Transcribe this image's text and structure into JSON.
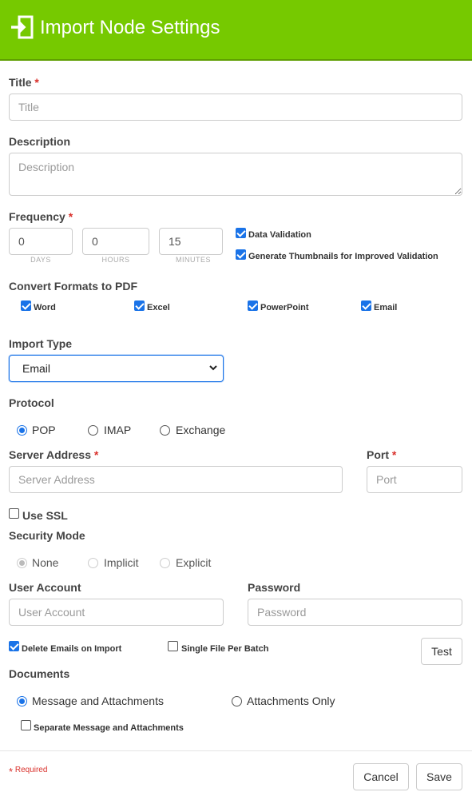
{
  "header": {
    "title": "Import Node Settings",
    "icon": "import-icon",
    "bg_color": "#76c900"
  },
  "title_field": {
    "label": "Title",
    "placeholder": "Title",
    "value": ""
  },
  "description_field": {
    "label": "Description",
    "placeholder": "Description",
    "value": ""
  },
  "frequency": {
    "label": "Frequency",
    "days": {
      "value": "0",
      "caption": "DAYS"
    },
    "hours": {
      "value": "0",
      "caption": "HOURS"
    },
    "minutes": {
      "value": "15",
      "caption": "MINUTES"
    },
    "data_validation": {
      "label": "Data Validation",
      "checked": true
    },
    "generate_thumbnails": {
      "label": "Generate Thumbnails for Improved Validation",
      "checked": true
    }
  },
  "convert_formats": {
    "label": "Convert Formats to PDF",
    "items": [
      {
        "label": "Word",
        "checked": true
      },
      {
        "label": "Excel",
        "checked": true
      },
      {
        "label": "PowerPoint",
        "checked": true
      },
      {
        "label": "Email",
        "checked": true
      }
    ]
  },
  "import_type": {
    "label": "Import Type",
    "selected": "Email"
  },
  "protocol": {
    "label": "Protocol",
    "options": [
      {
        "label": "POP",
        "selected": true
      },
      {
        "label": "IMAP",
        "selected": false
      },
      {
        "label": "Exchange",
        "selected": false
      }
    ]
  },
  "server_address": {
    "label": "Server Address",
    "placeholder": "Server Address",
    "value": ""
  },
  "port": {
    "label": "Port",
    "placeholder": "Port",
    "value": ""
  },
  "use_ssl": {
    "label": "Use SSL",
    "checked": false
  },
  "security_mode": {
    "label": "Security Mode",
    "options": [
      {
        "label": "None",
        "selected": true
      },
      {
        "label": "Implicit",
        "selected": false
      },
      {
        "label": "Explicit",
        "selected": false
      }
    ]
  },
  "user_account": {
    "label": "User Account",
    "placeholder": "User Account",
    "value": ""
  },
  "password": {
    "label": "Password",
    "placeholder": "Password",
    "value": ""
  },
  "delete_emails": {
    "label": "Delete Emails on Import",
    "checked": true
  },
  "single_file": {
    "label": "Single File Per Batch",
    "checked": false
  },
  "test_button": "Test",
  "documents": {
    "label": "Documents",
    "options": [
      {
        "label": "Message and Attachments",
        "selected": true
      },
      {
        "label": "Attachments Only",
        "selected": false
      }
    ],
    "separate": {
      "label": "Separate Message and Attachments",
      "checked": false
    }
  },
  "footer": {
    "required_note": "Required",
    "cancel": "Cancel",
    "save": "Save"
  },
  "colors": {
    "accent": "#1a73e8",
    "required": "#d9302b"
  }
}
